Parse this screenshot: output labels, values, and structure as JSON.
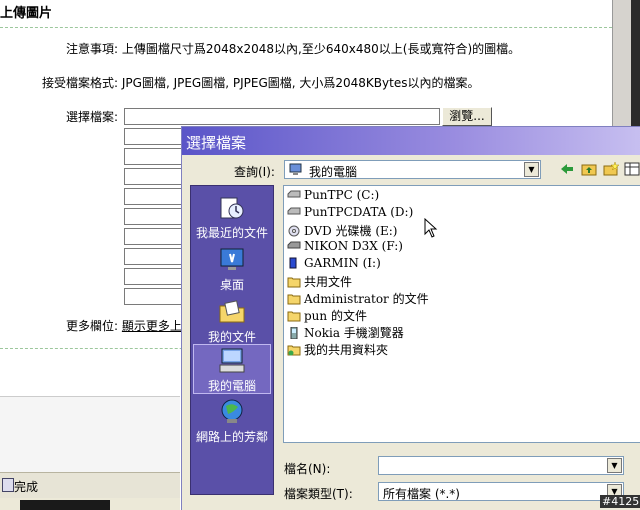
{
  "page": {
    "title": "上傳圖片",
    "notice_label": "注意事項:",
    "notice_text": "上傳圖檔尺寸爲2048x2048以內,至少640x480以上(長或寬符合)的圖檔。",
    "accept_label": "接受檔案格式:",
    "accept_text": "JPG圖檔, JPEG圖檔, PJPEG圖檔, 大小爲2048KBytes以內的檔案。",
    "choose_label": "選擇檔案:",
    "browse_label": "瀏覽...",
    "more_label": "更多欄位:",
    "more_link": "顯示更多上"
  },
  "statusbar": {
    "text": "完成"
  },
  "dialog": {
    "title": "選擇檔案",
    "lookin_label": "查詢(I):",
    "lookin_value": "我的電腦",
    "places": [
      {
        "label": "我最近的文件",
        "icon": "recent-documents-icon"
      },
      {
        "label": "桌面",
        "icon": "desktop-icon"
      },
      {
        "label": "我的文件",
        "icon": "my-documents-icon"
      },
      {
        "label": "我的電腦",
        "icon": "my-computer-icon",
        "selected": true
      },
      {
        "label": "網路上的芳鄰",
        "icon": "network-icon"
      }
    ],
    "files": [
      {
        "name": "PunTPC (C:)",
        "icon": "hard-drive-icon"
      },
      {
        "name": "PunTPCDATA (D:)",
        "icon": "hard-drive-icon"
      },
      {
        "name": "DVD 光碟機 (E:)",
        "icon": "dvd-drive-icon"
      },
      {
        "name": "NIKON D3X (F:)",
        "icon": "removable-drive-icon"
      },
      {
        "name": "GARMIN (I:)",
        "icon": "usb-drive-icon"
      },
      {
        "name": "共用文件",
        "icon": "folder-icon"
      },
      {
        "name": "Administrator 的文件",
        "icon": "folder-icon"
      },
      {
        "name": "pun 的文件",
        "icon": "folder-icon"
      },
      {
        "name": "Nokia 手機瀏覽器",
        "icon": "phone-browser-icon"
      },
      {
        "name": "我的共用資料夾",
        "icon": "shared-folder-icon"
      }
    ],
    "filename_label": "檔名(N):",
    "filename_value": "",
    "filetype_label": "檔案類型(T):",
    "filetype_value": "所有檔案 (*.*)"
  },
  "watermark": "#4125"
}
